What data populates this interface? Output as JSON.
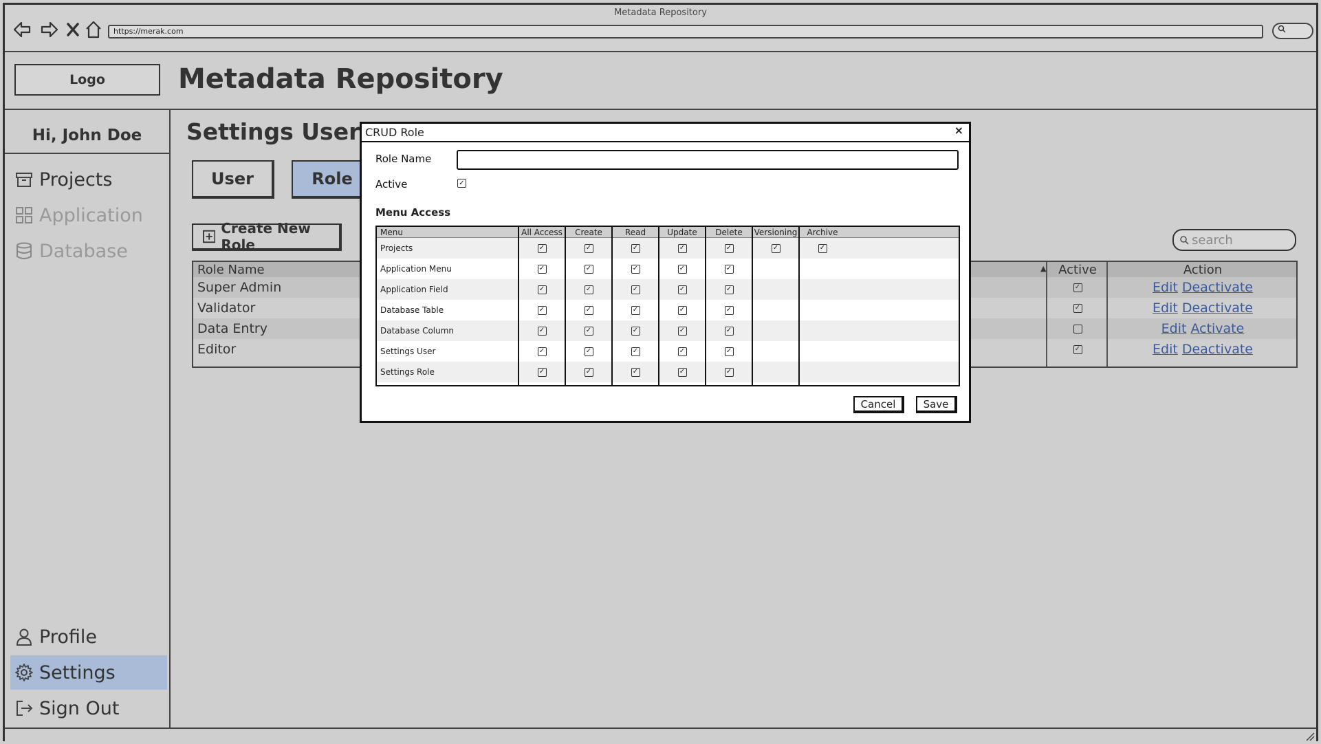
{
  "browser": {
    "window_title": "Metadata Repository",
    "url": "https://merak.com"
  },
  "header": {
    "logo": "Logo",
    "title": "Metadata Repository"
  },
  "sidebar": {
    "greeting": "Hi, John Doe",
    "items": [
      {
        "label": "Projects",
        "icon": "archive-icon",
        "state": "normal"
      },
      {
        "label": "Application",
        "icon": "grid-icon",
        "state": "disabled"
      },
      {
        "label": "Database",
        "icon": "database-icon",
        "state": "disabled"
      },
      {
        "label": "Profile",
        "icon": "user-icon",
        "state": "normal"
      },
      {
        "label": "Settings",
        "icon": "gear-icon",
        "state": "active"
      },
      {
        "label": "Sign Out",
        "icon": "sign-out-icon",
        "state": "normal"
      }
    ]
  },
  "content": {
    "title": "Settings User",
    "tabs": [
      {
        "label": "User",
        "selected": false
      },
      {
        "label": "Role",
        "selected": true
      }
    ],
    "create_button": "Create New Role",
    "search_placeholder": "search",
    "table": {
      "headers": [
        "Role Name",
        "Active",
        "Action"
      ],
      "rows": [
        {
          "name": "Super Admin",
          "active": true,
          "actions": [
            "Edit",
            "Deactivate"
          ]
        },
        {
          "name": "Validator",
          "active": true,
          "actions": [
            "Edit",
            "Deactivate"
          ]
        },
        {
          "name": "Data Entry",
          "active": false,
          "actions": [
            "Edit",
            "Activate"
          ]
        },
        {
          "name": "Editor",
          "active": true,
          "actions": [
            "Edit",
            "Deactivate"
          ]
        }
      ]
    }
  },
  "modal": {
    "title": "CRUD Role",
    "close": "×",
    "role_name_label": "Role Name",
    "role_name_value": "",
    "active_label": "Active",
    "active_checked": true,
    "menu_access_title": "Menu Access",
    "access_headers": [
      "Menu",
      "All Access",
      "Create",
      "Read",
      "Update",
      "Delete",
      "Versioning",
      "Archive"
    ],
    "access_rows": [
      {
        "menu": "Projects",
        "checks": [
          true,
          true,
          true,
          true,
          true,
          true,
          true
        ]
      },
      {
        "menu": "Application Menu",
        "checks": [
          true,
          true,
          true,
          true,
          true,
          null,
          null
        ]
      },
      {
        "menu": "Application Field",
        "checks": [
          true,
          true,
          true,
          true,
          true,
          null,
          null
        ]
      },
      {
        "menu": "Database Table",
        "checks": [
          true,
          true,
          true,
          true,
          true,
          null,
          null
        ]
      },
      {
        "menu": "Database Column",
        "checks": [
          true,
          true,
          true,
          true,
          true,
          null,
          null
        ]
      },
      {
        "menu": "Settings User",
        "checks": [
          true,
          true,
          true,
          true,
          true,
          null,
          null
        ]
      },
      {
        "menu": "Settings Role",
        "checks": [
          true,
          true,
          true,
          true,
          true,
          null,
          null
        ]
      }
    ],
    "cancel_label": "Cancel",
    "save_label": "Save"
  }
}
